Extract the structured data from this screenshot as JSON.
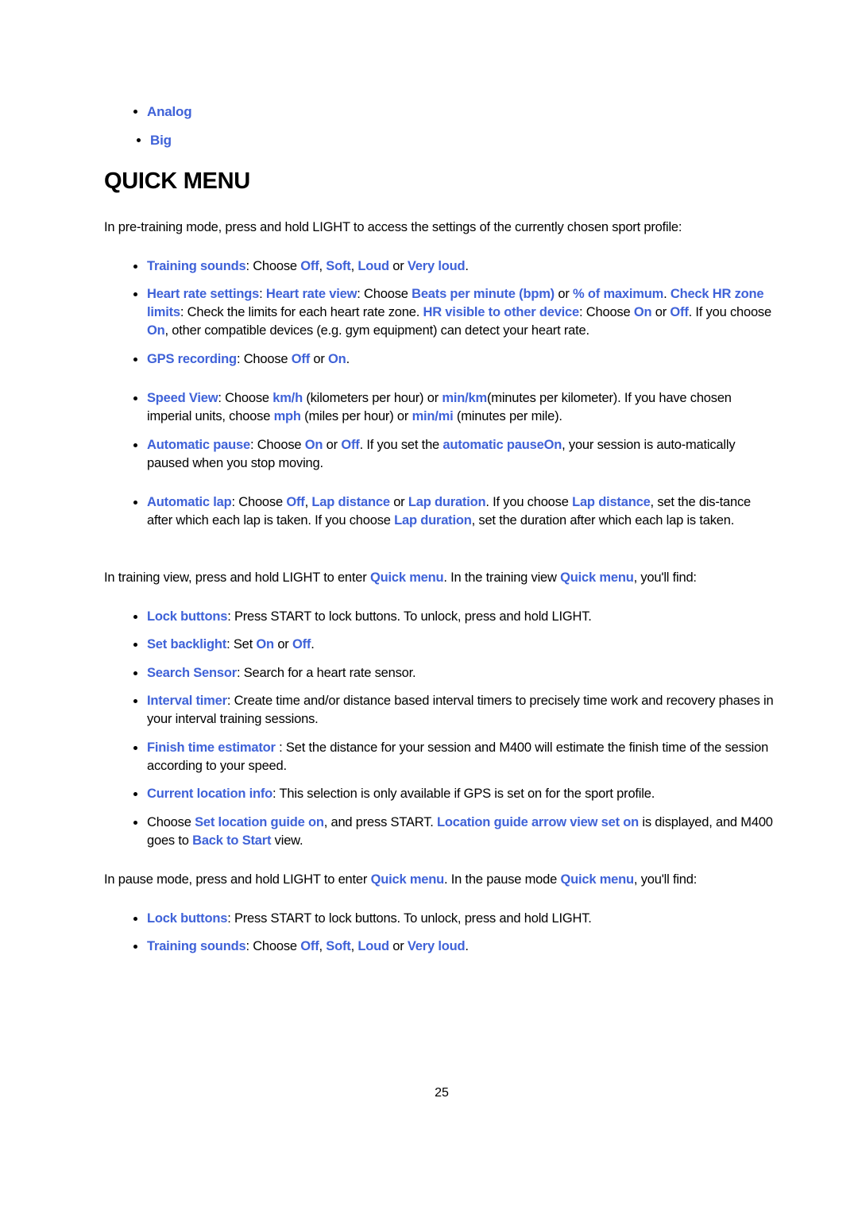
{
  "colors": {
    "link": "#3f62d8",
    "text": "#000000",
    "background": "#ffffff"
  },
  "top_list": [
    "Analog",
    "Big"
  ],
  "heading": "QUICK MENU",
  "intro": "In pre-training mode, press and hold LIGHT to access the settings of the currently chosen sport profile:",
  "pre_training_items": [
    [
      {
        "t": "Training sounds",
        "l": 1
      },
      {
        "t": ": Choose "
      },
      {
        "t": "Off",
        "l": 1
      },
      {
        "t": ", "
      },
      {
        "t": "Soft",
        "l": 1
      },
      {
        "t": ", "
      },
      {
        "t": "Loud",
        "l": 1
      },
      {
        "t": " or "
      },
      {
        "t": "Very loud",
        "l": 1
      },
      {
        "t": "."
      }
    ],
    [
      {
        "t": "Heart rate settings",
        "l": 1
      },
      {
        "t": ": "
      },
      {
        "t": "Heart rate view",
        "l": 1
      },
      {
        "t": ": Choose "
      },
      {
        "t": "Beats per minute (bpm)",
        "l": 1
      },
      {
        "t": " or "
      },
      {
        "t": "% of maximum",
        "l": 1
      },
      {
        "t": ". "
      },
      {
        "t": "Check HR zone limits",
        "l": 1
      },
      {
        "t": ": Check the limits for each heart rate zone. "
      },
      {
        "t": "HR visible to other device",
        "l": 1
      },
      {
        "t": ": Choose "
      },
      {
        "t": "On",
        "l": 1
      },
      {
        "t": " or "
      },
      {
        "t": "Off",
        "l": 1
      },
      {
        "t": ". If you choose "
      },
      {
        "t": "On",
        "l": 1
      },
      {
        "t": ", other compatible devices (e.g. gym equipment) can detect your heart rate."
      }
    ],
    [
      {
        "t": "GPS recording",
        "l": 1
      },
      {
        "t": ": Choose "
      },
      {
        "t": "Off",
        "l": 1
      },
      {
        "t": " or "
      },
      {
        "t": "On",
        "l": 1
      },
      {
        "t": "."
      }
    ],
    [
      {
        "t": "Speed View",
        "l": 1
      },
      {
        "t": ": Choose "
      },
      {
        "t": "km/h",
        "l": 1
      },
      {
        "t": " (kilometers per hour) or "
      },
      {
        "t": "min/km",
        "l": 1
      },
      {
        "t": "(minutes per kilometer). If you have chosen imperial units, choose "
      },
      {
        "t": "mph",
        "l": 1
      },
      {
        "t": " (miles per hour) or "
      },
      {
        "t": "min/mi",
        "l": 1
      },
      {
        "t": " (minutes per mile)."
      }
    ],
    [
      {
        "t": "Automatic pause",
        "l": 1
      },
      {
        "t": ": Choose "
      },
      {
        "t": "On",
        "l": 1
      },
      {
        "t": " or "
      },
      {
        "t": "Off",
        "l": 1
      },
      {
        "t": ". If you set the "
      },
      {
        "t": "automatic pauseOn",
        "l": 1
      },
      {
        "t": ", your session is auto-matically paused when you stop moving."
      }
    ],
    [
      {
        "t": "Automatic lap",
        "l": 1
      },
      {
        "t": ": Choose "
      },
      {
        "t": "Off",
        "l": 1
      },
      {
        "t": ", "
      },
      {
        "t": "Lap distance",
        "l": 1
      },
      {
        "t": " or "
      },
      {
        "t": "Lap duration",
        "l": 1
      },
      {
        "t": ". If you choose "
      },
      {
        "t": "Lap distance",
        "l": 1
      },
      {
        "t": ", set the dis-tance after which each lap is taken. If you choose "
      },
      {
        "t": "Lap duration",
        "l": 1
      },
      {
        "t": ", set the duration after which each lap is taken."
      }
    ]
  ],
  "training_intro": [
    {
      "t": "In training view, press and hold LIGHT to enter "
    },
    {
      "t": "Quick menu",
      "l": 1
    },
    {
      "t": ". In the training view "
    },
    {
      "t": "Quick menu",
      "l": 1
    },
    {
      "t": ", you'll find:"
    }
  ],
  "training_items": [
    [
      {
        "t": "Lock buttons",
        "l": 1
      },
      {
        "t": ": Press START to lock buttons. To unlock, press and hold LIGHT."
      }
    ],
    [
      {
        "t": "Set backlight",
        "l": 1
      },
      {
        "t": ": Set "
      },
      {
        "t": "On",
        "l": 1
      },
      {
        "t": " or "
      },
      {
        "t": "Off",
        "l": 1
      },
      {
        "t": "."
      }
    ],
    [
      {
        "t": "Search Sensor",
        "l": 1
      },
      {
        "t": ": Search for a heart rate sensor."
      }
    ],
    [
      {
        "t": "Interval timer",
        "l": 1
      },
      {
        "t": ": Create time and/or distance based interval timers to precisely time work and recovery phases in your interval training sessions."
      }
    ],
    [
      {
        "t": "Finish time estimator",
        "l": 1
      },
      {
        "t": " : Set the distance for your session and M400 will estimate the finish time of the session according to your speed."
      }
    ],
    [
      {
        "t": "Current location info",
        "l": 1
      },
      {
        "t": ": This selection is only available if GPS is set on for the sport profile."
      }
    ],
    [
      {
        "t": "Choose "
      },
      {
        "t": "Set location guide on",
        "l": 1
      },
      {
        "t": ", and press START.  "
      },
      {
        "t": "Location guide arrow view set on",
        "l": 1
      },
      {
        "t": " is displayed, and M400 goes to "
      },
      {
        "t": "Back to Start",
        "l": 1
      },
      {
        "t": " view."
      }
    ]
  ],
  "pause_intro": [
    {
      "t": "In pause mode, press and hold LIGHT to enter "
    },
    {
      "t": "Quick menu",
      "l": 1
    },
    {
      "t": ". In the pause mode "
    },
    {
      "t": "Quick menu",
      "l": 1
    },
    {
      "t": ", you'll find:"
    }
  ],
  "pause_items": [
    [
      {
        "t": "Lock buttons",
        "l": 1
      },
      {
        "t": ": Press START to lock buttons. To unlock, press and hold LIGHT."
      }
    ],
    [
      {
        "t": "Training sounds",
        "l": 1
      },
      {
        "t": ": Choose "
      },
      {
        "t": "Off",
        "l": 1
      },
      {
        "t": ", "
      },
      {
        "t": "Soft",
        "l": 1
      },
      {
        "t": ", "
      },
      {
        "t": "Loud",
        "l": 1
      },
      {
        "t": " or "
      },
      {
        "t": "Very loud",
        "l": 1
      },
      {
        "t": "."
      }
    ]
  ],
  "page_number": "25"
}
